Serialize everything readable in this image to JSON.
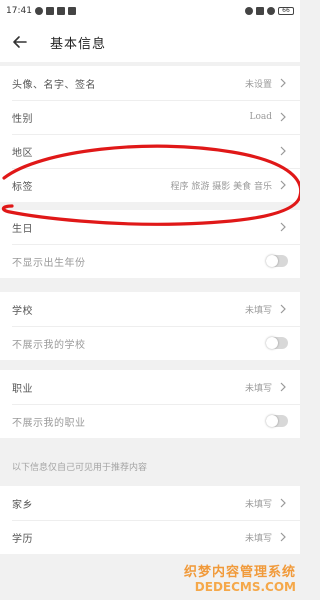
{
  "status_bar": {
    "time": "17:41",
    "battery": "66"
  },
  "header": {
    "title": "基本信息"
  },
  "group1": [
    {
      "label": "头像、名字、签名",
      "value": "未设置"
    },
    {
      "label": "性别",
      "value": "Load"
    },
    {
      "label": "地区",
      "value": ""
    },
    {
      "label": "标签",
      "value": "程序 旅游 摄影 美食 音乐"
    }
  ],
  "group2": {
    "rows": [
      {
        "label": "生日",
        "value": ""
      }
    ],
    "toggle_label": "不显示出生年份"
  },
  "group3": {
    "row": {
      "label": "学校",
      "value": "未填写"
    },
    "toggle_label": "不展示我的学校"
  },
  "group4": {
    "row": {
      "label": "职业",
      "value": "未填写"
    },
    "toggle_label": "不展示我的职业"
  },
  "section_note": "以下信息仅自己可见用于推荐内容",
  "group5": [
    {
      "label": "家乡",
      "value": "未填写"
    },
    {
      "label": "学历",
      "value": "未填写"
    }
  ],
  "watermark": {
    "line1": "织梦内容管理系统",
    "line2": "DEDECMS.COM"
  },
  "colors": {
    "annotation": "#e01818",
    "watermark": "#f19a3a"
  }
}
